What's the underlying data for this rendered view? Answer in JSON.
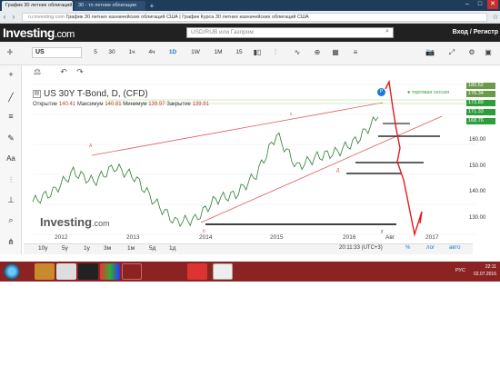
{
  "browser": {
    "tabs": [
      {
        "label": "График 30 летних облигаций"
      },
      {
        "label": "30 - тл летние облигации"
      }
    ],
    "new_tab": "+",
    "url_host": "ru.investing.com",
    "url_title": "График 30 летних казначейских облигаций США | График Курса 30 летних казначейских облигаций США"
  },
  "site": {
    "logo": "Investing",
    "logo_suffix": ".com",
    "search_placeholder": "USD/RUB или Газпром",
    "login": "Вход / Регистр"
  },
  "toolbar": {
    "symbol": "US",
    "timeframes": [
      "5",
      "30",
      "1ч",
      "4ч",
      "1D",
      "1W",
      "1M",
      "15"
    ],
    "active_timeframe": "1D"
  },
  "chart": {
    "title": "US 30Y T-Bond, D, (CFD)",
    "open_label": "Открытие",
    "open": "140.41",
    "high_label": "Максимум",
    "high": "140.81",
    "low_label": "Минимум",
    "low": "139.97",
    "close_label": "Закрытие",
    "close": "139.91",
    "legend_label": "торговая сессия",
    "badges": [
      "180.62",
      "176.34",
      "173.89",
      "171.33",
      "168.76"
    ],
    "badge_colors": [
      "#4a8f3c",
      "#4a8f3c",
      "#2e9e3a",
      "#2e9e3a",
      "#2e9e3a"
    ],
    "y_ticks": [
      "160.00",
      "150.00",
      "140.00",
      "130.00"
    ],
    "x_ticks": [
      "2012",
      "2013",
      "2014",
      "2015",
      "2016",
      "Авг",
      "2017"
    ],
    "wave_labels": [
      "A",
      "c",
      "b",
      "a",
      "ц",
      "b",
      "c",
      "y",
      "Д",
      "5"
    ],
    "watermark": "Investing",
    "watermark_suffix": ".com"
  },
  "chart_data": {
    "type": "line",
    "title": "US 30Y T-Bond, D, (CFD)",
    "x": [
      "2011.7",
      "2012.0",
      "2012.3",
      "2012.6",
      "2012.9",
      "2013.2",
      "2013.5",
      "2013.8",
      "2014.0",
      "2014.3",
      "2014.6",
      "2014.9",
      "2015.1",
      "2015.4",
      "2015.7",
      "2016.0",
      "2016.3",
      "2016.6"
    ],
    "series": [
      {
        "values": [
          138,
          142,
          150,
          146,
          152,
          148,
          138,
          130,
          131,
          139,
          141,
          149,
          165,
          152,
          156,
          158,
          163,
          172
        ]
      }
    ],
    "ylim": [
      125,
      185
    ],
    "xlabel": "",
    "ylabel": "",
    "grid": true
  },
  "ranges": [
    "10у",
    "5у",
    "1у",
    "3м",
    "1м",
    "5д",
    "1д"
  ],
  "clock": "20:11:33 (UTC+3)",
  "bottom_right": [
    "%",
    "лог",
    "авто"
  ],
  "tray": {
    "lang": "РУС",
    "time": "22:11",
    "date": "02.07.2016"
  }
}
